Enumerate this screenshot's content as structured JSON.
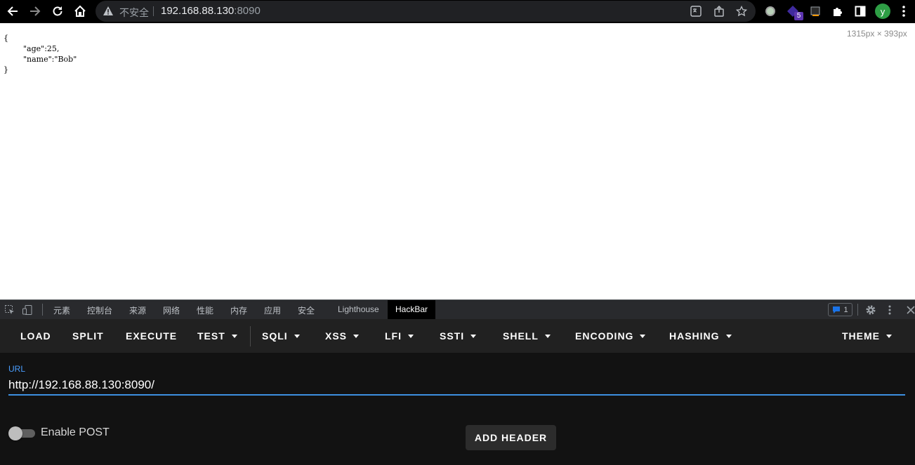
{
  "browser": {
    "security_text": "不安全",
    "url_host": "192.168.88.130",
    "url_port": ":8090",
    "avatar_letter": "y",
    "extension_badge": "5",
    "icons": [
      "back-arrow-icon",
      "forward-arrow-icon",
      "reload-icon",
      "home-icon",
      "warning-icon",
      "translate-icon",
      "share-icon",
      "star-icon",
      "extension-icon",
      "puzzle-icon",
      "side-panel-icon",
      "more-vert-icon"
    ]
  },
  "page": {
    "json_text": "{\n        \"age\":25,\n        \"name\":\"Bob\"\n}",
    "dimension_readout": "1315px × 393px"
  },
  "devtools": {
    "tabs": [
      "元素",
      "控制台",
      "来源",
      "网络",
      "性能",
      "内存",
      "应用",
      "安全",
      "Lighthouse",
      "HackBar"
    ],
    "active_tab": "HackBar",
    "issues_count": "1"
  },
  "hackbar": {
    "menu": {
      "load": "LOAD",
      "split": "SPLIT",
      "execute": "EXECUTE",
      "test": "TEST",
      "sqli": "SQLI",
      "xss": "XSS",
      "lfi": "LFI",
      "ssti": "SSTI",
      "shell": "SHELL",
      "encoding": "ENCODING",
      "hashing": "HASHING",
      "theme": "THEME"
    },
    "url_label": "URL",
    "url_value": "http://192.168.88.130:8090/",
    "enable_post_label": "Enable POST",
    "enable_post": false,
    "add_header_label": "ADD HEADER",
    "colors": {
      "accent": "#3d8fe0",
      "menu_bg": "#212121",
      "body_bg": "#121212"
    }
  }
}
